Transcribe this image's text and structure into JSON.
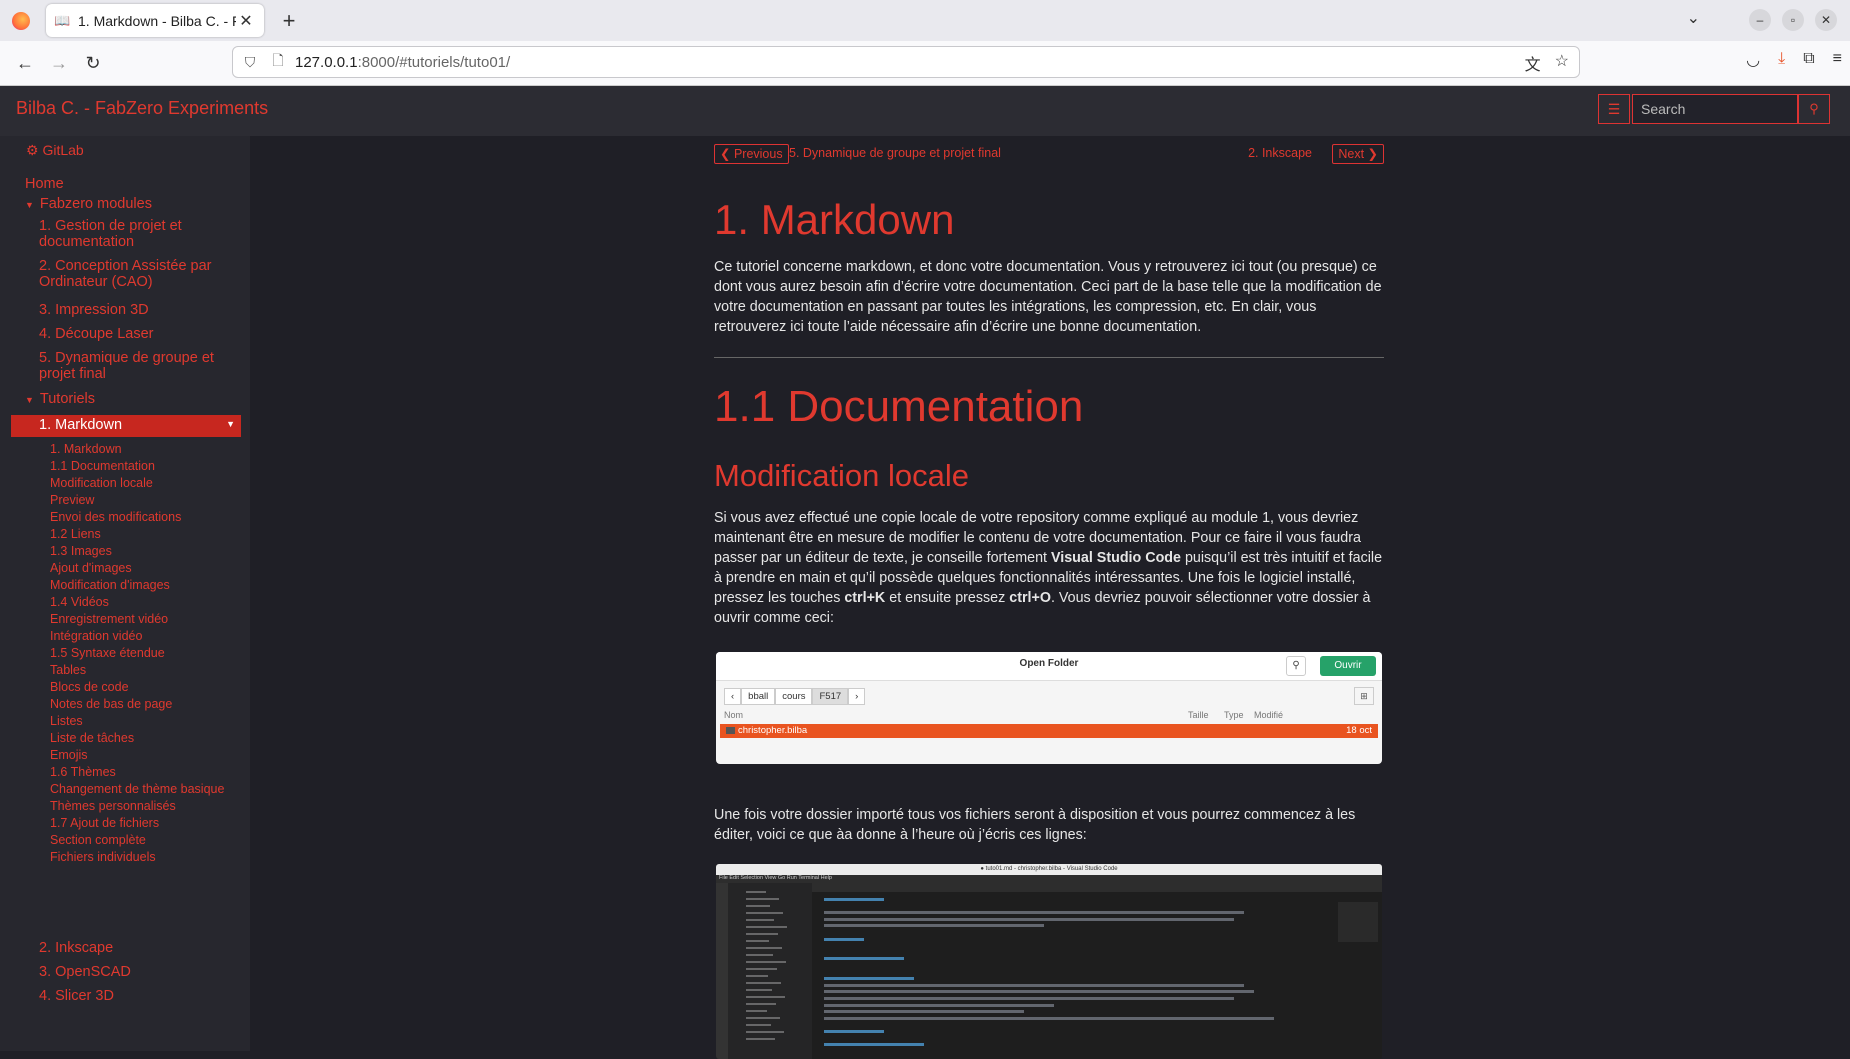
{
  "browser": {
    "tab_title": "1. Markdown - Bilba C. - F",
    "url_host": "127.0.0.1",
    "url_rest": ":8000/#tutoriels/tuto01/"
  },
  "header": {
    "site_title": "Bilba C. - FabZero Experiments",
    "search_placeholder": "Search"
  },
  "sidebar": {
    "gitlab": "GitLab",
    "home": "Home",
    "fabzero_modules": "Fabzero modules",
    "modules": [
      "1. Gestion de projet et",
      "documentation",
      "2. Conception Assistée par",
      "Ordinateur (CAO)",
      "3. Impression 3D",
      "4. Découpe Laser",
      "5. Dynamique de groupe et",
      "projet final"
    ],
    "tutoriels": "Tutoriels",
    "active": "1. Markdown",
    "toc": [
      "1. Markdown",
      "1.1 Documentation",
      "Modification locale",
      "Preview",
      "Envoi des modifications",
      "1.2 Liens",
      "1.3 Images",
      "Ajout d'images",
      "Modification d'images",
      "1.4 Vidéos",
      "Enregistrement vidéo",
      "Intégration vidéo",
      "1.5 Syntaxe étendue",
      "Tables",
      "Blocs de code",
      "Notes de bas de page",
      "Listes",
      "Liste de tâches",
      "Emojis",
      "1.6 Thèmes",
      "Changement de thème basique",
      "Thèmes personnalisés",
      "1.7 Ajout de fichiers",
      "Section complète",
      "Fichiers individuels"
    ],
    "after": [
      "2. Inkscape",
      "3. OpenSCAD",
      "4. Slicer 3D"
    ]
  },
  "pager": {
    "prev_label": "Previous",
    "prev_title": "5. Dynamique de groupe et projet final",
    "next_title": "2. Inkscape",
    "next_label": "Next"
  },
  "content": {
    "h1": "1. Markdown",
    "intro": "Ce tutoriel concerne markdown, et donc votre documentation. Vous y retrouverez ici tout (ou presque) ce dont vous aurez besoin afin d’écrire votre documentation. Ceci part de la base telle que la modification de votre documentation en passant par toutes les intégrations, les compression, etc. En clair, vous retrouverez ici toute l’aide nécessaire afin d’écrire une bonne documentation.",
    "h1b": "1.1 Documentation",
    "h2": "Modification locale",
    "p1_a": "Si vous avez effectué une copie locale de votre repository comme expliqué au module 1, vous devriez maintenant être en mesure de modifier le contenu de votre documentation. Pour ce faire il vous faudra passer par un éditeur de texte, je conseille fortement ",
    "p1_b": "Visual Studio Code",
    "p1_c": " puisqu’il est très intuitif et facile à prendre en main et qu’il possède quelques fonctionnalités intéressantes. Une fois le logiciel installé, pressez les touches ",
    "p1_d": "ctrl+K",
    "p1_e": " et ensuite pressez ",
    "p1_f": "ctrl+O",
    "p1_g": ". Vous devriez pouvoir sélectionner votre dossier à ouvrir comme ceci:",
    "p2": "Une fois votre dossier importé tous vos fichiers seront à disposition et vous pourrez commencez à les éditer, voici ce que àa donne à l’heure où j’écris ces lignes:"
  },
  "open_folder": {
    "title": "Open Folder",
    "open_button": "Ouvrir",
    "crumbs": [
      "bball",
      "cours",
      "F517"
    ],
    "col_name": "Nom",
    "col_size": "Taille",
    "col_type": "Type",
    "col_modified": "Modifié",
    "row_name": "christopher.bilba",
    "row_date": "18 oct"
  },
  "vscode": {
    "title": "● tuto01.md - christopher.bilba - Visual Studio Code",
    "menu": "File  Edit  Selection  View  Go  Run  Terminal  Help"
  }
}
